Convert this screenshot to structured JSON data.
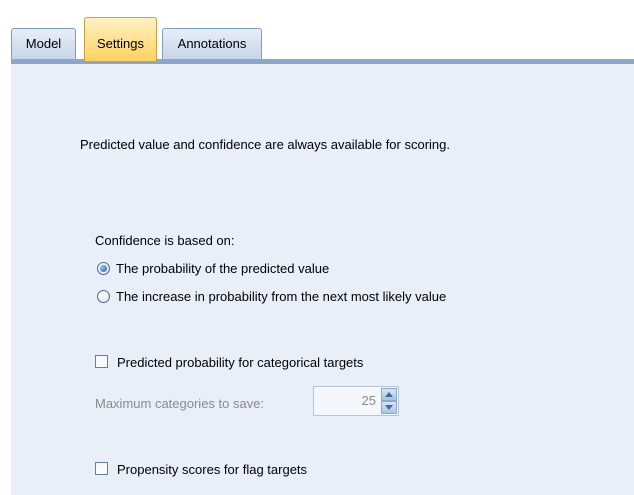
{
  "tabs": [
    {
      "label": "Model",
      "active": false
    },
    {
      "label": "Settings",
      "active": true
    },
    {
      "label": "Annotations",
      "active": false
    }
  ],
  "info_text": "Predicted value and confidence are always available for scoring.",
  "confidence": {
    "label": "Confidence is based on:",
    "options": [
      {
        "label": "The probability of the predicted value",
        "selected": true
      },
      {
        "label": "The increase in probability from the next most likely value",
        "selected": false
      }
    ]
  },
  "predicted_probability": {
    "label": "Predicted probability for categorical targets",
    "checked": false
  },
  "max_categories": {
    "label": "Maximum categories to save:",
    "value": "25",
    "enabled": false
  },
  "propensity": {
    "label": "Propensity scores for flag targets",
    "checked": false
  },
  "colors": {
    "active_tab": "#ffd25c",
    "panel_bg": "#e8eff8",
    "radio_selected": "#1f5fb0"
  }
}
